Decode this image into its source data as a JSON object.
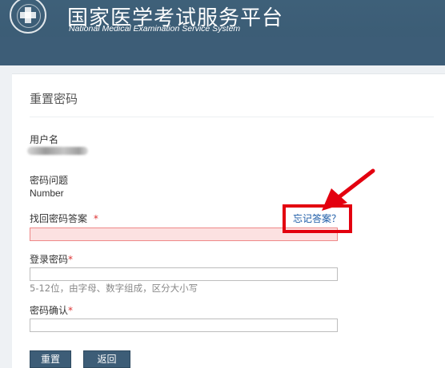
{
  "header": {
    "title_cn": "国家医学考试服务平台",
    "title_en": "National Medical Examination Service System"
  },
  "page_title": "重置密码",
  "username": {
    "label": "用户名",
    "value_obscured": true
  },
  "question": {
    "label": "密码问题",
    "value": "Number"
  },
  "answer": {
    "label": "找回密码答案",
    "required_mark": "*",
    "value": "",
    "forgot_link": "忘记答案？"
  },
  "password": {
    "label": "登录密码",
    "required_mark": "*",
    "value": "",
    "hint": "5-12位，由字母、数字组成，区分大小写"
  },
  "confirm": {
    "label": "密码确认",
    "required_mark": "*",
    "value": ""
  },
  "buttons": {
    "reset": "重置",
    "back": "返回"
  },
  "colors": {
    "header": "#3e6079",
    "error_field": "#fce1e1",
    "annotation": "#e3000f",
    "link": "#1b5aa6"
  }
}
